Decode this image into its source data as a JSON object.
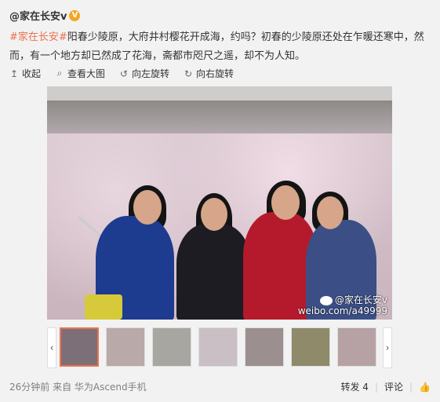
{
  "post": {
    "author": "@家在长安v",
    "verified_badge": "V",
    "tag": "#家在长安#",
    "text": "阳春少陵原，大府井村樱花开成海，约吗？初春的少陵原还处在乍暖还寒中，然而，有一个地方却已然成了花海，斋都市咫尺之遥，却不为人知。"
  },
  "toolbar": {
    "collect": "收起",
    "view_large": "查看大图",
    "rotate_left": "向左旋转",
    "rotate_right": "向右旋转"
  },
  "photo": {
    "watermark_line1": "@家在长安v",
    "watermark_line2": "weibo.com/a49999"
  },
  "thumbnails": [
    {
      "color": "#7d6f78"
    },
    {
      "color": "#b9a9a8"
    },
    {
      "color": "#a8a6a0"
    },
    {
      "color": "#c9bfc4"
    },
    {
      "color": "#9c8f8f"
    },
    {
      "color": "#8e8a6a"
    },
    {
      "color": "#b6a1a5"
    }
  ],
  "footer": {
    "meta": "26分钟前 来自 华为Ascend手机",
    "repost": "转发 4",
    "comment": "评论",
    "like_icon": "thumbs-up-icon"
  },
  "icons": {
    "collapse": "↥",
    "search": "⌕",
    "rotate_left": "↺",
    "rotate_right": "↻",
    "prev": "‹",
    "next": "›",
    "like": "👍"
  }
}
